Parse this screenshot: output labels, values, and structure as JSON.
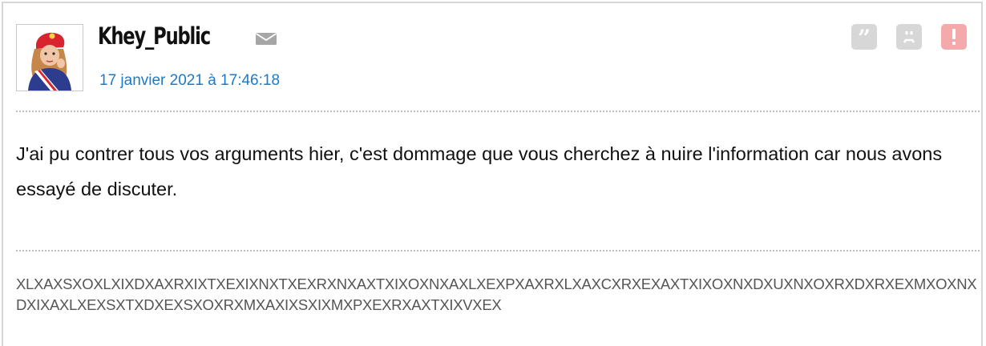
{
  "post": {
    "author": "Khey_Public",
    "date": "17 janvier 2021 à 17:46:18",
    "message": "J'ai pu contrer tous vos arguments hier, c'est dommage que vous cherchez à nuire l'information car nous avons essayé de discuter.",
    "signature": "XLXAXSXOXLXIXDXAXRXIXTXEXIXNXTXEXRXNXAXTXIXOXNXAXLXEXPXAXRXLXAXCXRXEXAXTXIXOXNXDXUXNXOXRXDXRXEXMXOXNXDXIXAXLXEXSXTXDXEXSXOXRXMXAXIXSXIXMXPXEXRXAXTXIXVXEX"
  },
  "icons": {
    "mail": "envelope-icon",
    "quote": "quote-icon",
    "sad": "sad-face-icon",
    "report": "exclamation-icon"
  },
  "colors": {
    "date_link": "#1e7ac4",
    "action_button": "#d7d7d7",
    "report_button": "#f4aaaa",
    "border": "#d6d6d6",
    "signature_text": "#555555"
  }
}
